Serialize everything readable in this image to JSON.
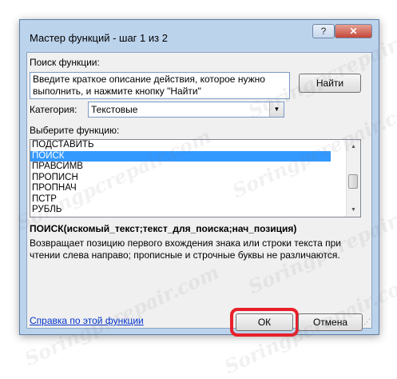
{
  "window": {
    "title": "Мастер функций - шаг 1 из 2",
    "help_glyph": "?",
    "close_glyph": "✕"
  },
  "search": {
    "label": "Поиск функции:",
    "value": "Введите краткое описание действия, которое нужно выполнить, и нажмите кнопку \"Найти\"",
    "find_button": "Найти"
  },
  "category": {
    "label": "Категория:",
    "selected": "Текстовые"
  },
  "functions": {
    "label": "Выберите функцию:",
    "items": [
      "ПОДСТАВИТЬ",
      "ПОИСК",
      "ПРАВСИМВ",
      "ПРОПИСН",
      "ПРОПНАЧ",
      "ПСТР",
      "РУБЛЬ"
    ],
    "selected_index": 1
  },
  "details": {
    "syntax": "ПОИСК(искомый_текст;текст_для_поиска;нач_позиция)",
    "description": "Возвращает позицию первого вхождения знака или строки текста при чтении слева направо; прописные и строчные буквы не различаются."
  },
  "footer": {
    "help_link": "Справка по этой функции",
    "ok_button": "ОК",
    "cancel_button": "Отмена"
  },
  "watermark": "Soringpcrepair.com",
  "colors": {
    "selection": "#3399ff",
    "highlight_ring": "#e8202a",
    "link": "#0033cc",
    "frame": "#bcd3ec"
  }
}
